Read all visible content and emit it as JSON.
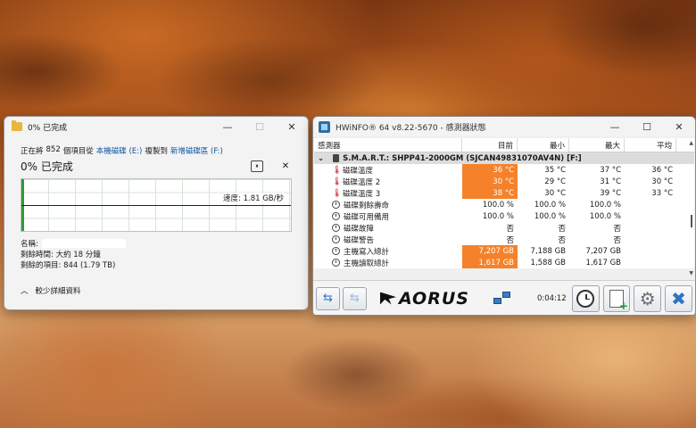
{
  "copy_dialog": {
    "title": "0% 已完成",
    "line_prefix": "正在將",
    "items_count": "852",
    "line_mid": "個項目從",
    "source": "本機磁碟 (E:)",
    "line_to": "複製到",
    "dest": "新增磁碟區 (F:)",
    "percent_label": "0% 已完成",
    "pause_label": "⏸",
    "cancel_label": "✕",
    "speed": "速度: 1.81 GB/秒",
    "name_label": "名稱:",
    "time_left": "剩餘時間: 大約 18 分鐘",
    "items_left": "剩餘的項目: 844 (1.79 TB)",
    "less_details": "較少詳細資料",
    "progress_fraction": 0.0,
    "title_minimize": "—",
    "title_maximize": "☐",
    "title_close": "✕"
  },
  "hwinfo": {
    "title": "HWiNFO® 64 v8.22-5670 - 感測器狀態",
    "title_minimize": "—",
    "title_maximize": "☐",
    "title_close": "✕",
    "columns": {
      "sensor": "感測器",
      "current": "目前",
      "min": "最小",
      "max": "最大",
      "avg": "平均"
    },
    "group_label": "S.M.A.R.T.: SHPP41-2000GM (SJCAN49831070AV4N) [F:]",
    "rows": [
      {
        "name": "磁碟溫度",
        "current": "36 °C",
        "min": "35 °C",
        "max": "37 °C",
        "avg": "36 °C",
        "icon": "thermometer"
      },
      {
        "name": "磁碟溫度 2",
        "current": "30 °C",
        "min": "29 °C",
        "max": "31 °C",
        "avg": "30 °C",
        "icon": "thermometer"
      },
      {
        "name": "磁碟溫度 3",
        "current": "38 °C",
        "min": "30 °C",
        "max": "39 °C",
        "avg": "33 °C",
        "icon": "thermometer"
      },
      {
        "name": "磁碟剩餘壽命",
        "current": "100.0 %",
        "min": "100.0 %",
        "max": "100.0 %",
        "avg": "",
        "icon": "clock"
      },
      {
        "name": "磁碟可用備用",
        "current": "100.0 %",
        "min": "100.0 %",
        "max": "100.0 %",
        "avg": "",
        "icon": "clock"
      },
      {
        "name": "磁碟故障",
        "current": "否",
        "min": "否",
        "max": "否",
        "avg": "",
        "icon": "clock"
      },
      {
        "name": "磁碟警告",
        "current": "否",
        "min": "否",
        "max": "否",
        "avg": "",
        "icon": "clock"
      },
      {
        "name": "主機寫入總計",
        "current": "7,207 GB",
        "min": "7,188 GB",
        "max": "7,207 GB",
        "avg": "",
        "icon": "clock"
      },
      {
        "name": "主機讀取總計",
        "current": "1,617 GB",
        "min": "1,588 GB",
        "max": "1,617 GB",
        "avg": "",
        "icon": "clock"
      }
    ],
    "highlight_rows": [
      0,
      1,
      2,
      7,
      8
    ],
    "highlight_color": "#f5822a",
    "toolbar": {
      "brand": "AORUS",
      "timer": "0:04:12",
      "nav_prev_icon": "⇆",
      "nav_next_icon": "⇆",
      "settings_icon": "⚙",
      "close_icon": "✖"
    }
  }
}
